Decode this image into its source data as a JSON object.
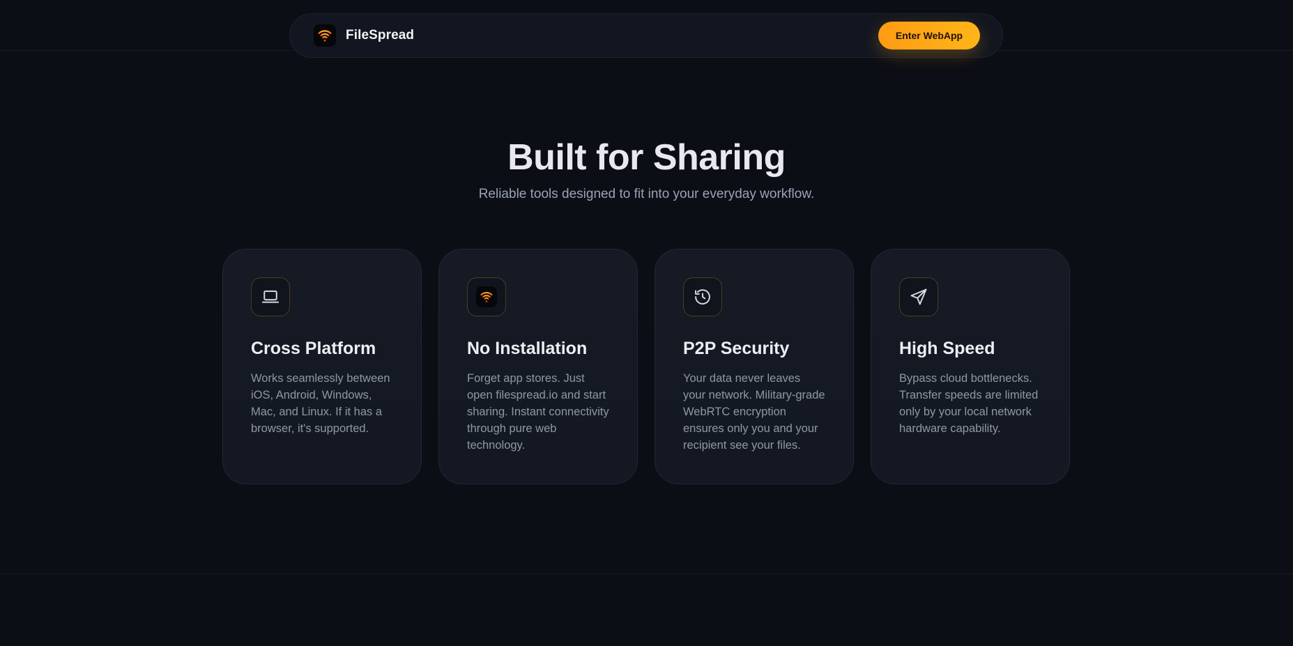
{
  "nav": {
    "brand_name": "FileSpread",
    "brand_logo_icon": "wifi-signal-icon",
    "cta_label": "Enter WebApp"
  },
  "hero": {
    "title": "Built for Sharing",
    "subtitle": "Reliable tools designed to fit into your everyday workflow."
  },
  "features": [
    {
      "icon": "laptop-icon",
      "title": "Cross Platform",
      "description": "Works seamlessly between iOS, Android, Windows, Mac, and Linux. If it has a browser, it's supported."
    },
    {
      "icon": "wifi-signal-icon",
      "title": "No Installation",
      "description": "Forget app stores. Just open filespread.io and start sharing. Instant connectivity through pure web technology."
    },
    {
      "icon": "history-icon",
      "title": "P2P Security",
      "description": "Your data never leaves your network. Military-grade WebRTC encryption ensures only you and your recipient see your files."
    },
    {
      "icon": "paper-plane-icon",
      "title": "High Speed",
      "description": "Bypass cloud bottlenecks. Transfer speeds are limited only by your local network hardware capability."
    }
  ],
  "colors": {
    "background": "#0b0e15",
    "accent": "#ffa516",
    "card": "#151a24"
  }
}
